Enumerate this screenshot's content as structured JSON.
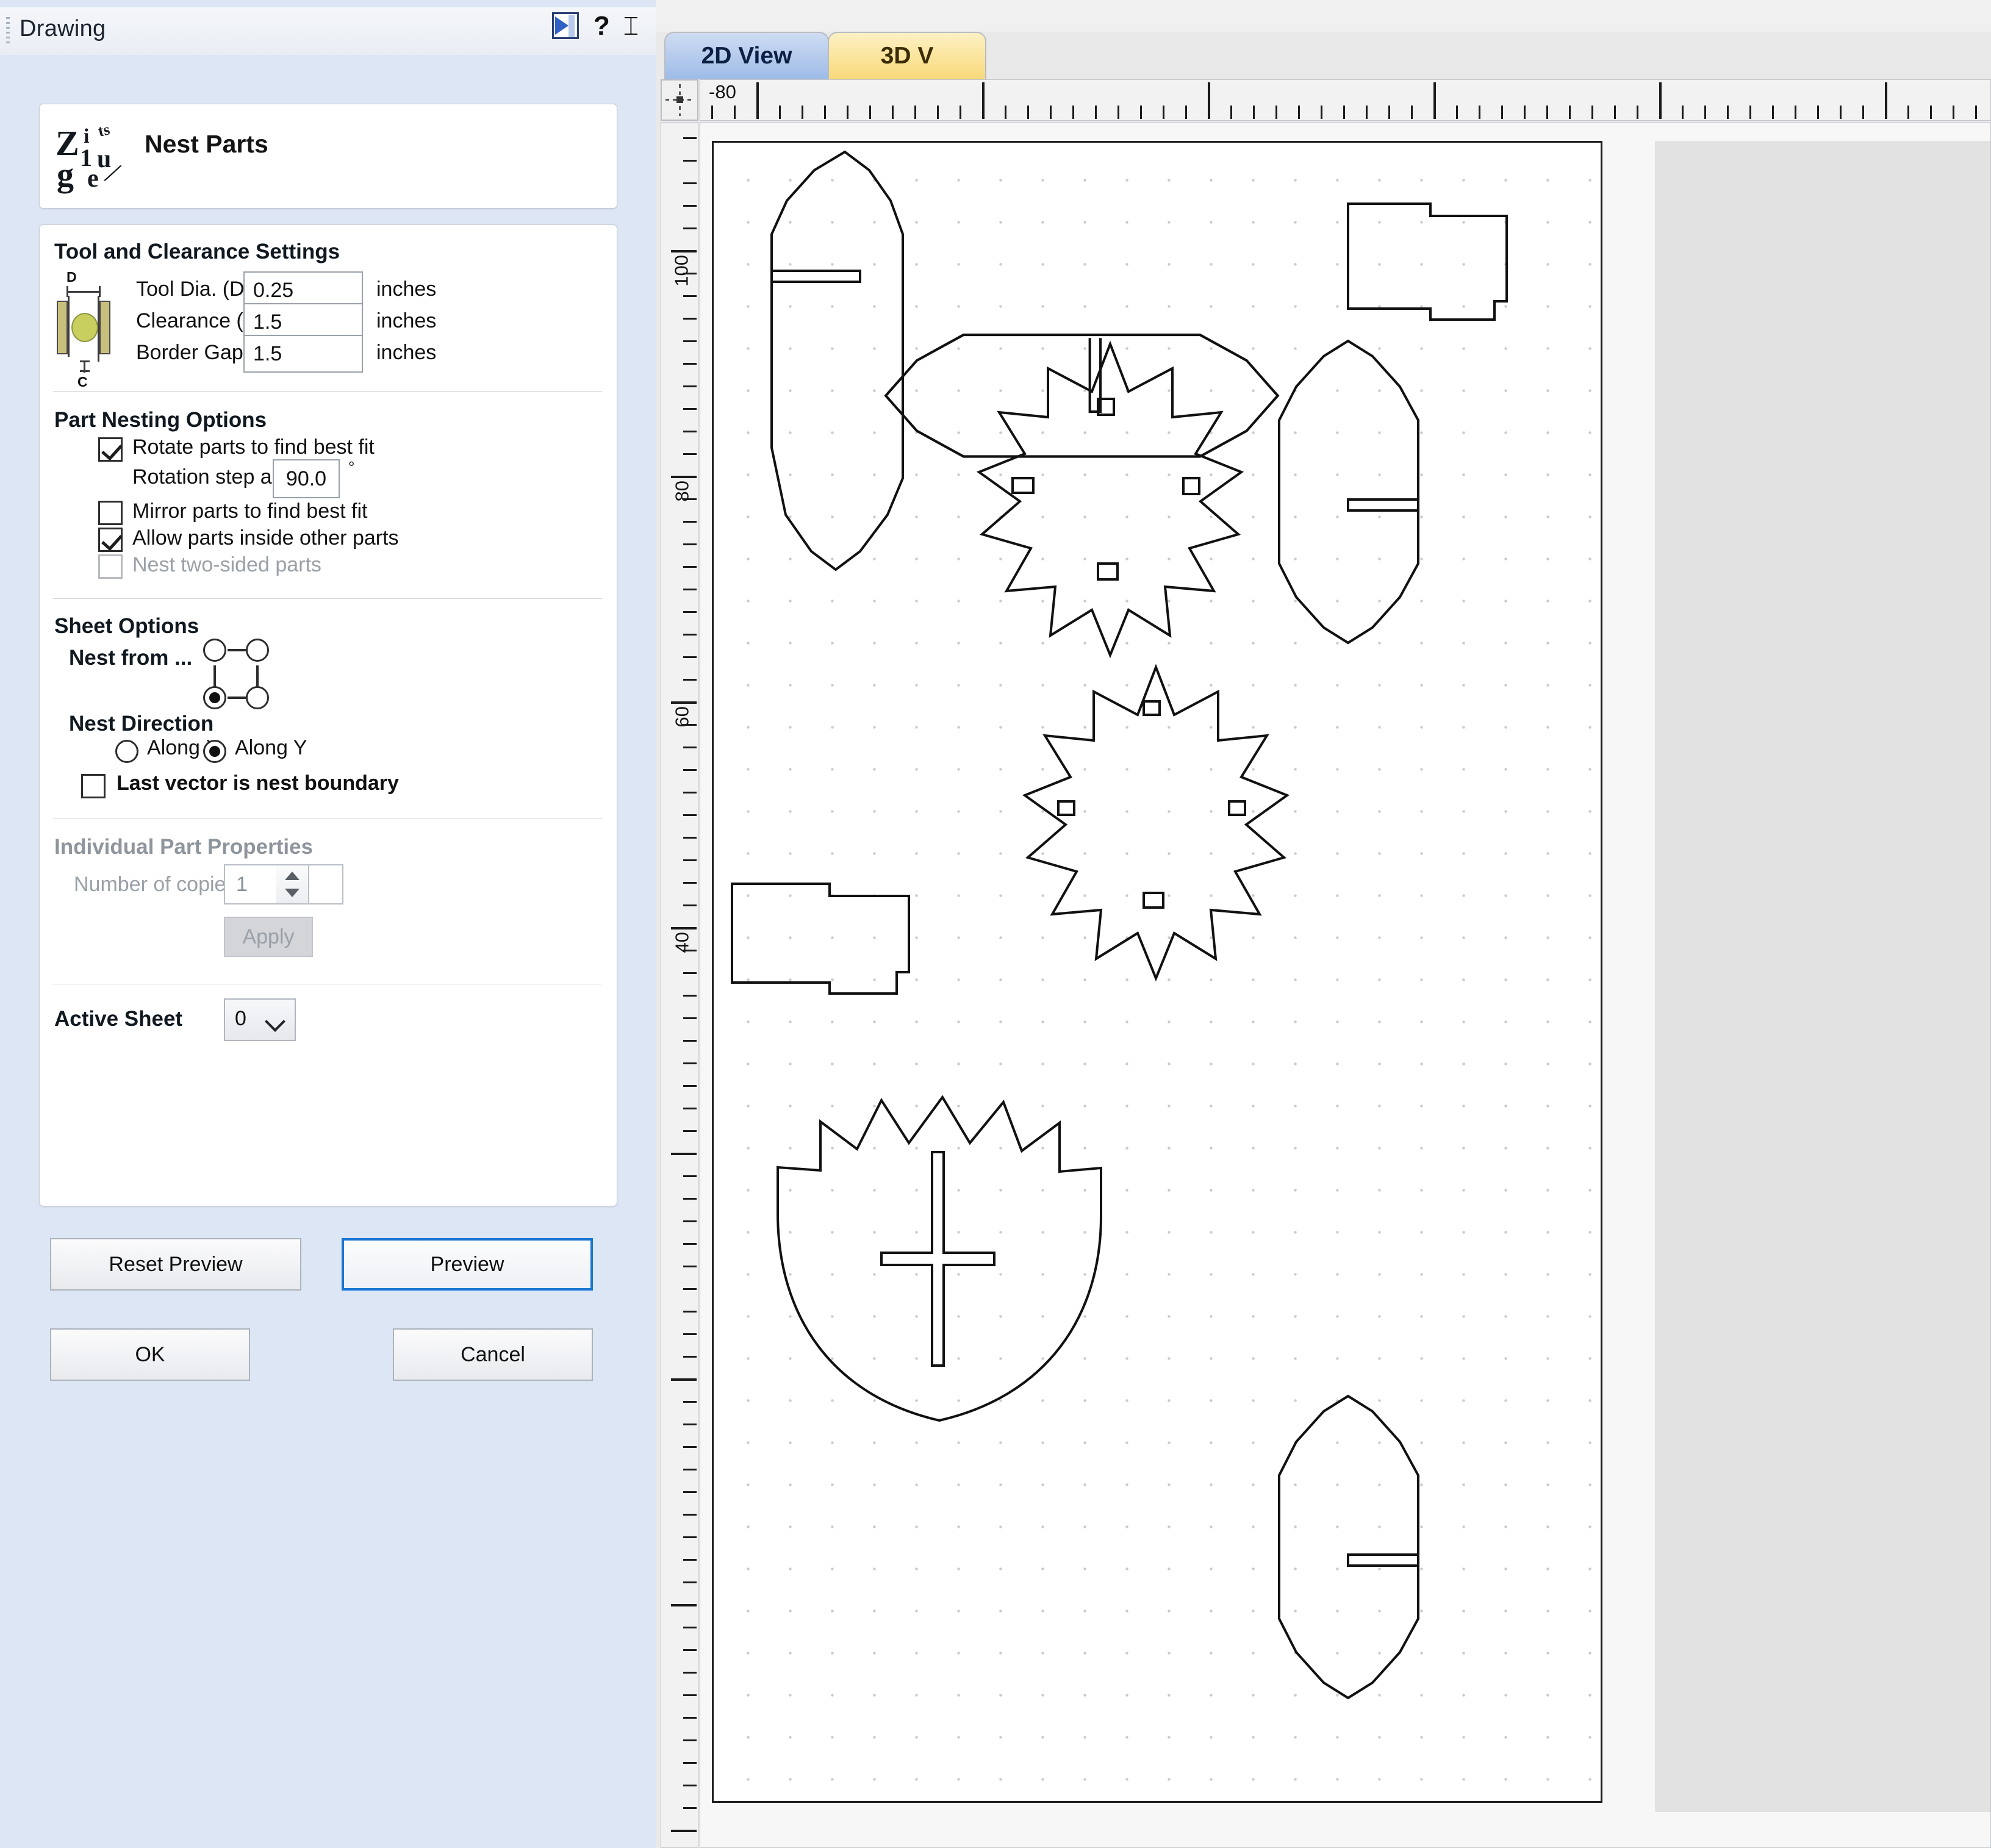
{
  "panel": {
    "title": "Drawing",
    "icons": {
      "autohide": "autohide-icon",
      "help": "?",
      "pin": "⌶"
    },
    "header": {
      "logo_alt": "vectric-zigzag-logo",
      "title": "Nest Parts"
    },
    "tool_clearance": {
      "section_title": "Tool and Clearance Settings",
      "diagram_labels": {
        "d": "D",
        "c": "C"
      },
      "fields": [
        {
          "label": "Tool Dia. (D)",
          "value": "0.25",
          "unit": "inches"
        },
        {
          "label": "Clearance (C)",
          "value": "1.5",
          "unit": "inches"
        },
        {
          "label": "Border Gap",
          "value": "1.5",
          "unit": "inches"
        }
      ]
    },
    "part_nesting": {
      "section_title": "Part Nesting Options",
      "rotate_parts": {
        "label": "Rotate parts to find best fit",
        "checked": true,
        "enabled": true
      },
      "rotation_step": {
        "label": "Rotation step angle",
        "value": "90.0",
        "unit": "°"
      },
      "mirror_parts": {
        "label": "Mirror parts to find best fit",
        "checked": false,
        "enabled": true
      },
      "allow_inside": {
        "label": "Allow parts inside other parts",
        "checked": true,
        "enabled": true
      },
      "two_sided": {
        "label": "Nest two-sided parts",
        "checked": false,
        "enabled": false
      }
    },
    "sheet_options": {
      "section_title": "Sheet Options",
      "nest_from_label": "Nest from ...",
      "nest_from_corners": [
        {
          "name": "top-left",
          "selected": false
        },
        {
          "name": "top-right",
          "selected": false
        },
        {
          "name": "bottom-left",
          "selected": true
        },
        {
          "name": "bottom-right",
          "selected": false
        }
      ],
      "nest_direction_label": "Nest Direction",
      "nest_direction": [
        {
          "label": "Along X",
          "selected": false
        },
        {
          "label": "Along Y",
          "selected": true
        }
      ],
      "last_vector_boundary": {
        "label": "Last vector is nest boundary",
        "checked": false
      }
    },
    "individual_part": {
      "section_title": "Individual Part Properties",
      "copies_label": "Number of copies",
      "copies_value": "1",
      "apply_label": "Apply",
      "enabled": false
    },
    "active_sheet": {
      "label": "Active Sheet",
      "value": "0",
      "options": [
        "0"
      ]
    },
    "buttons": {
      "reset_preview": "Reset Preview",
      "preview": "Preview",
      "ok": "OK",
      "cancel": "Cancel"
    }
  },
  "view": {
    "tabs": [
      {
        "label": "2D View",
        "active": true
      },
      {
        "label": "3D V",
        "active": false
      }
    ],
    "h_ruler": {
      "label": "-80"
    },
    "v_ruler": {
      "labels": [
        "100",
        "80",
        "60",
        "40"
      ]
    }
  },
  "colors": {
    "panel_bg": "#dce6f5",
    "card_bg": "#ffffff",
    "accent_blue": "#1976d2",
    "tab_active": "#9dbbe8",
    "tab_inactive": "#f8d97a",
    "outline": "#1f1f1f"
  }
}
